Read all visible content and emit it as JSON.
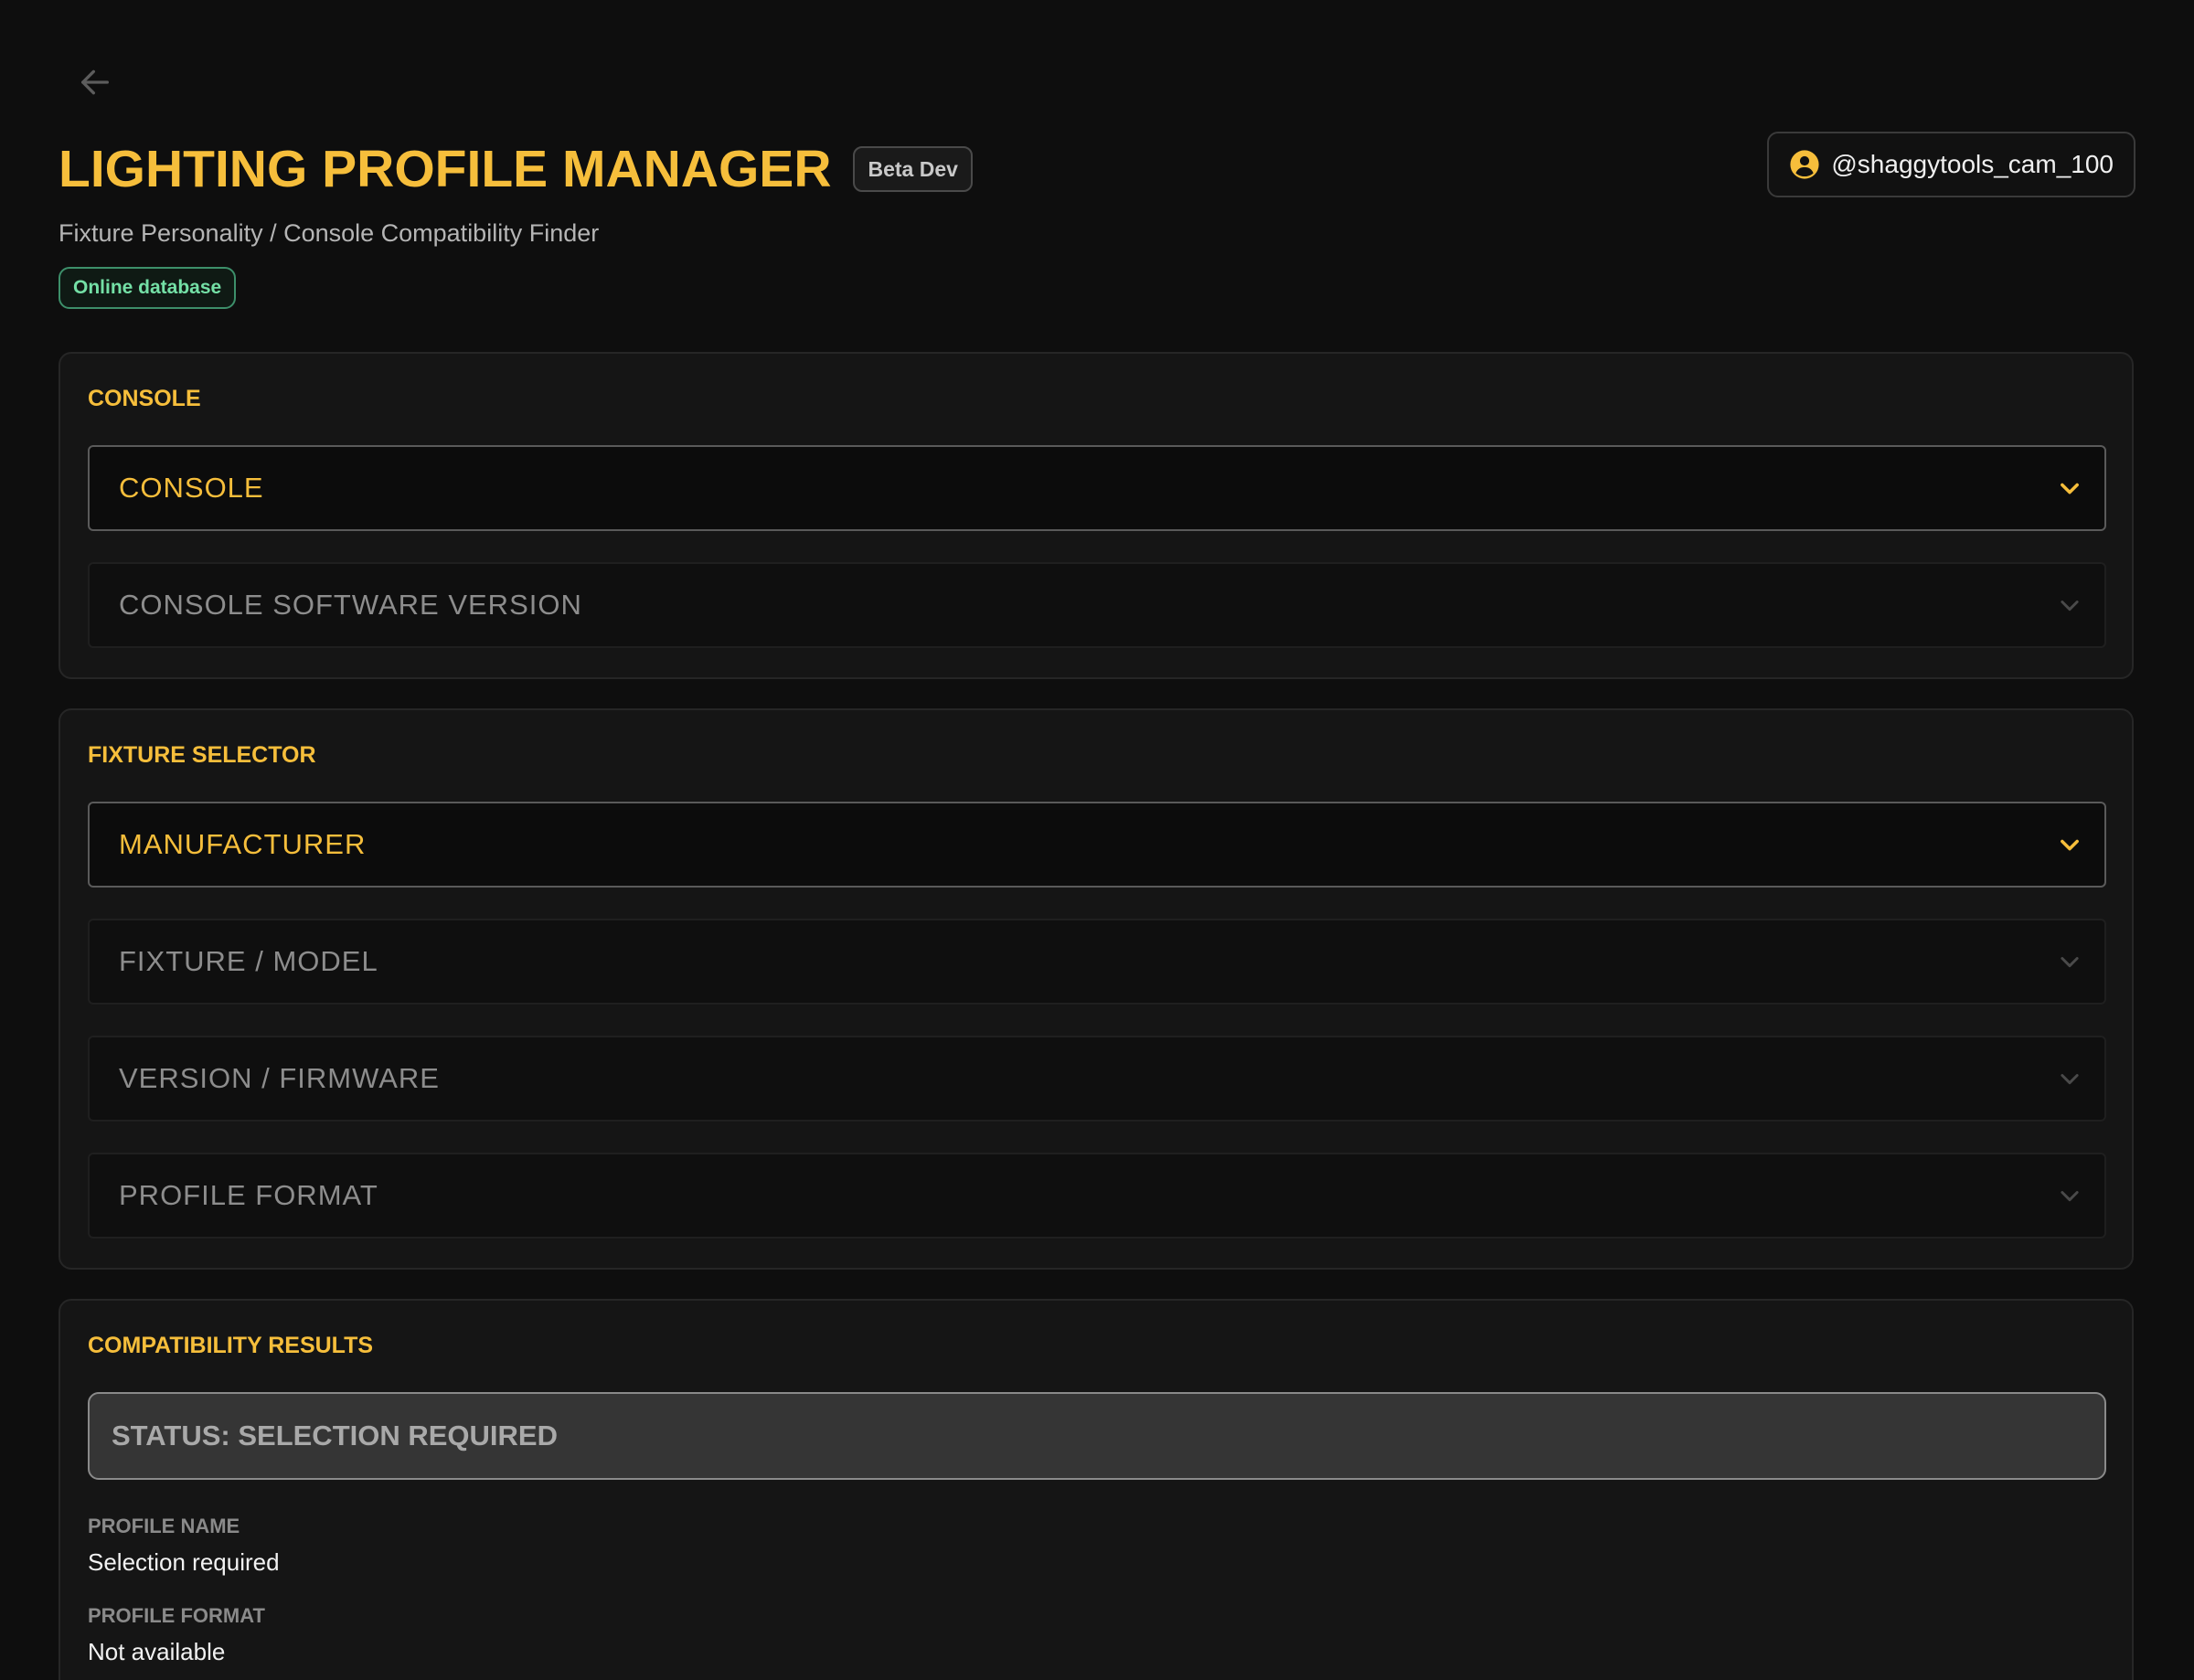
{
  "header": {
    "title": "LIGHTING PROFILE MANAGER",
    "badge": "Beta Dev",
    "subtitle": "Fixture Personality / Console Compatibility Finder",
    "db_status": "Online database",
    "back_icon": "arrow-left-icon"
  },
  "user": {
    "handle": "@shaggytools_cam_100",
    "icon": "user-circle-icon"
  },
  "console_section": {
    "title": "CONSOLE",
    "selects": [
      {
        "label": "CONSOLE",
        "state": "active"
      },
      {
        "label": "CONSOLE SOFTWARE VERSION",
        "state": "disabled"
      }
    ]
  },
  "fixture_section": {
    "title": "FIXTURE SELECTOR",
    "selects": [
      {
        "label": "MANUFACTURER",
        "state": "active"
      },
      {
        "label": "FIXTURE / MODEL",
        "state": "disabled"
      },
      {
        "label": "VERSION / FIRMWARE",
        "state": "disabled"
      },
      {
        "label": "PROFILE FORMAT",
        "state": "disabled"
      }
    ]
  },
  "results_section": {
    "title": "COMPATIBILITY RESULTS",
    "status": "STATUS: SELECTION REQUIRED",
    "fields": [
      {
        "label": "PROFILE NAME",
        "value": "Selection required"
      },
      {
        "label": "PROFILE FORMAT",
        "value": "Not available"
      }
    ]
  },
  "colors": {
    "accent": "#f6be3b",
    "background": "#0e0e0e",
    "card": "#151515",
    "online": "#74e0a6"
  }
}
